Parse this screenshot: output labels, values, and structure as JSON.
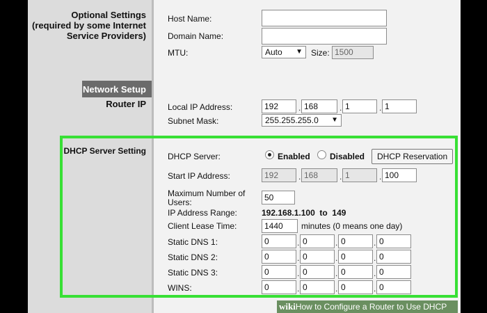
{
  "sections": {
    "optional_line1": "Optional Settings",
    "optional_line2": "(required by some Internet",
    "optional_line3": "Service Providers)",
    "network_setup": "Network Setup",
    "router_ip": "Router IP",
    "dhcp_server_setting": "DHCP Server Setting"
  },
  "optional": {
    "host_name_label": "Host Name:",
    "host_name_value": "",
    "domain_name_label": "Domain Name:",
    "domain_name_value": "",
    "mtu_label": "MTU:",
    "mtu_value": "Auto",
    "size_label": "Size:",
    "size_value": "1500"
  },
  "router": {
    "local_ip_label": "Local IP Address:",
    "local_ip": [
      "192",
      "168",
      "1",
      "1"
    ],
    "subnet_label": "Subnet Mask:",
    "subnet_value": "255.255.255.0"
  },
  "dhcp": {
    "server_label": "DHCP Server:",
    "enabled_label": "Enabled",
    "disabled_label": "Disabled",
    "selected": "Enabled",
    "reservation_button": "DHCP Reservation",
    "start_ip_label": "Start IP Address:",
    "start_ip": [
      "192",
      "168",
      "1",
      "100"
    ],
    "max_users_line1": "Maximum Number of",
    "max_users_line2": "Users:",
    "max_users_value": "50",
    "range_label": "IP Address Range:",
    "range_value": "192.168.1.100  to  149",
    "lease_label": "Client Lease Time:",
    "lease_value": "1440",
    "lease_note": "minutes (0 means one day)",
    "dns1_label": "Static DNS 1:",
    "dns1": [
      "0",
      "0",
      "0",
      "0"
    ],
    "dns2_label": "Static DNS 2:",
    "dns2": [
      "0",
      "0",
      "0",
      "0"
    ],
    "dns3_label": "Static DNS 3:",
    "dns3": [
      "0",
      "0",
      "0",
      "0"
    ],
    "wins_label": "WINS:",
    "wins": [
      "0",
      "0",
      "0",
      "0"
    ]
  },
  "watermark": {
    "brand": "wiki",
    "text": "How to Configure a Router to Use DHCP"
  },
  "colors": {
    "highlight": "#38e035",
    "section_bar": "#6b6b6b"
  }
}
